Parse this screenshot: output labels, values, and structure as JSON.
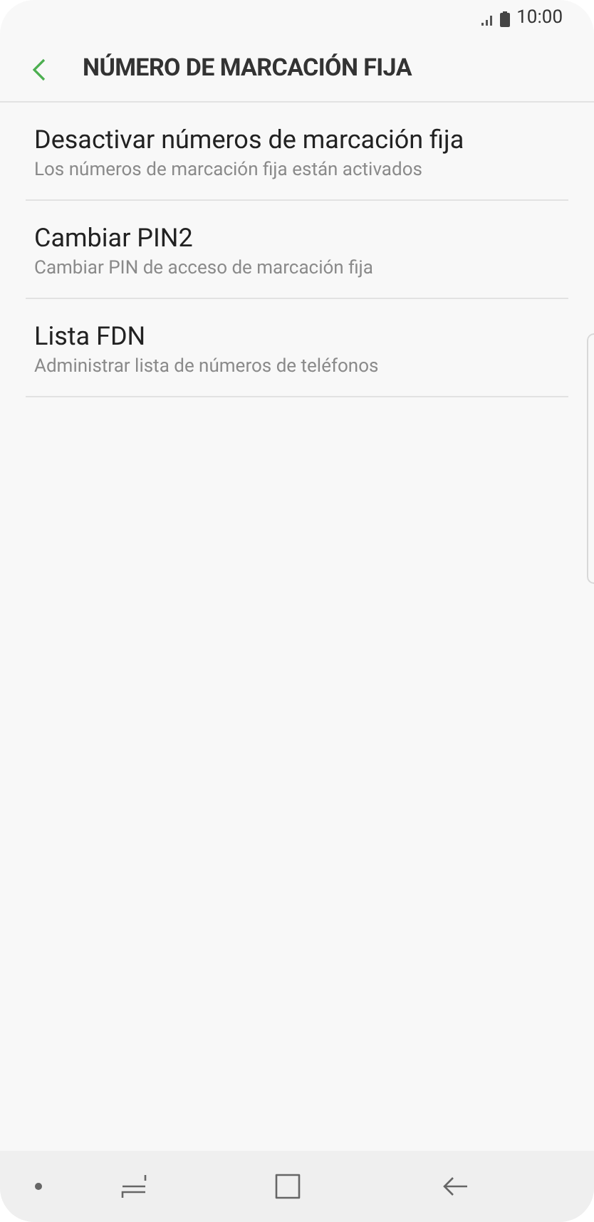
{
  "status_bar": {
    "time": "10:00"
  },
  "header": {
    "title": "NÚMERO DE MARCACIÓN FIJA"
  },
  "items": [
    {
      "title": "Desactivar números de marcación fija",
      "subtitle": "Los números de marcación fija están activados"
    },
    {
      "title": "Cambiar PIN2",
      "subtitle": "Cambiar PIN de acceso de marcación fija"
    },
    {
      "title": "Lista FDN",
      "subtitle": "Administrar lista de números de teléfonos"
    }
  ]
}
